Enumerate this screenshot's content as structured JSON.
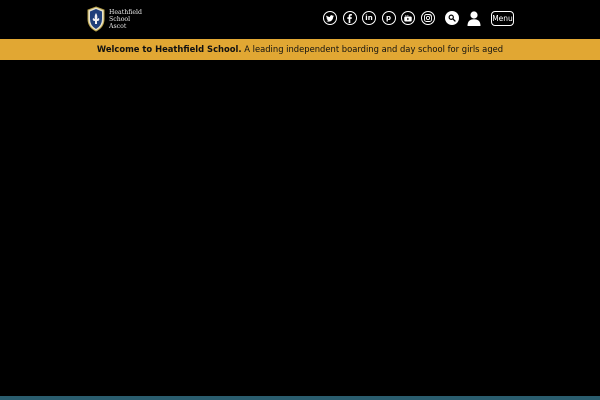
{
  "brand": {
    "name_line1": "Heathfield",
    "name_line2": "School",
    "name_line3": "Ascot",
    "accent_color": "#e1a733"
  },
  "header": {
    "social": [
      {
        "network": "twitter",
        "icon": "twitter-icon"
      },
      {
        "network": "facebook",
        "icon": "facebook-icon"
      },
      {
        "network": "linkedin",
        "icon": "linkedin-icon",
        "glyph": "in"
      },
      {
        "network": "pinterest",
        "icon": "pinterest-icon",
        "glyph": "p"
      },
      {
        "network": "youtube",
        "icon": "youtube-icon"
      },
      {
        "network": "instagram",
        "icon": "instagram-icon"
      }
    ],
    "search_icon": "search-icon",
    "account_icon": "user-icon",
    "menu_label": "Menu"
  },
  "banner": {
    "bold_text": "Welcome to Heathfield School.",
    "text": " A leading independent boarding and day school for girls aged"
  }
}
